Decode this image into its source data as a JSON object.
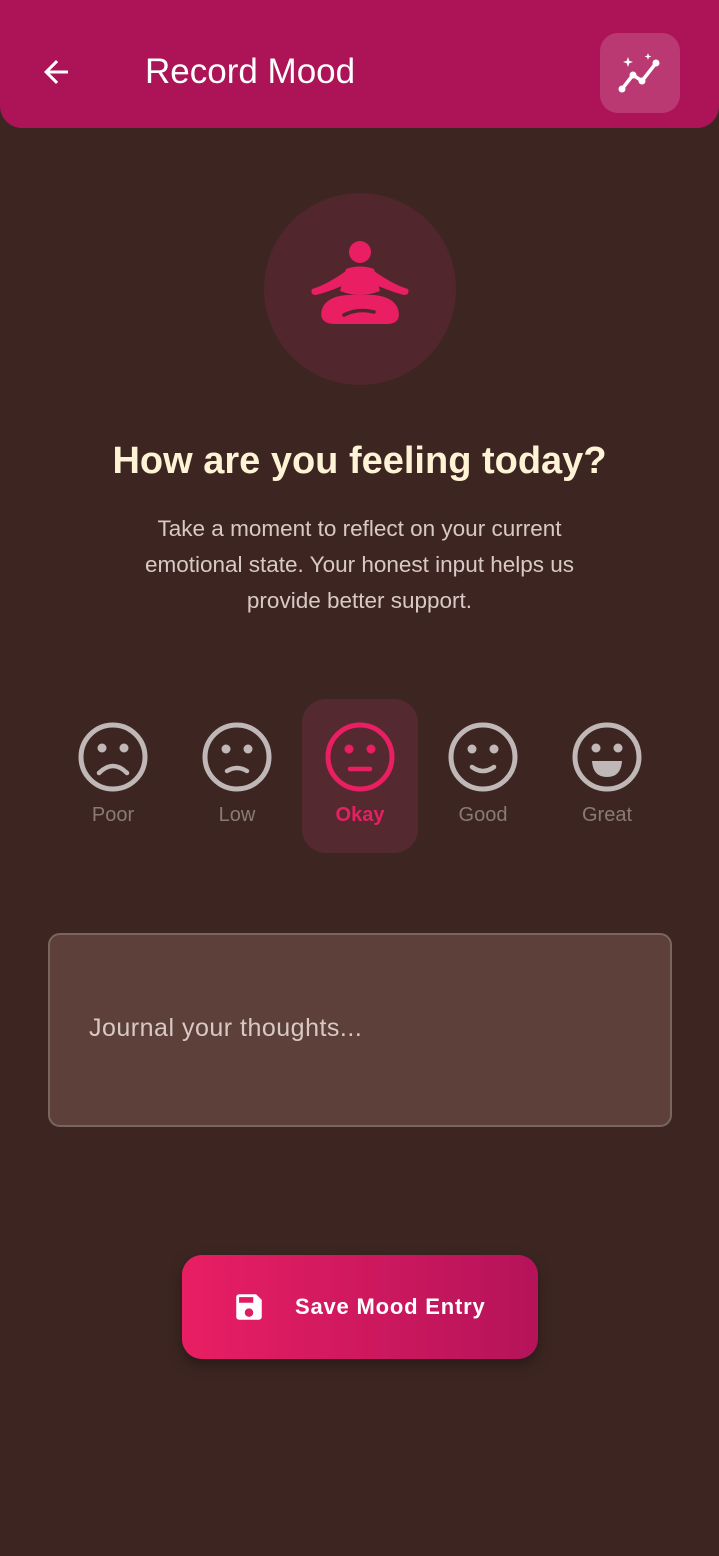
{
  "app_bar": {
    "title": "Record Mood",
    "back_icon": "arrow-left-icon",
    "action_icon": "insights-icon"
  },
  "hero": {
    "icon": "meditation-icon"
  },
  "prompt": {
    "heading": "How are you feeling today?",
    "subtitle": "Take a moment to reflect on your current emotional state. Your honest input helps us provide better support."
  },
  "moods": {
    "selected": "Okay",
    "items": [
      {
        "label": "Poor",
        "icon": "sad-face-icon"
      },
      {
        "label": "Low",
        "icon": "dissatisfied-face-icon"
      },
      {
        "label": "Okay",
        "icon": "neutral-face-icon"
      },
      {
        "label": "Good",
        "icon": "satisfied-face-icon"
      },
      {
        "label": "Great",
        "icon": "very-satisfied-face-icon"
      }
    ]
  },
  "journal": {
    "placeholder": "Journal your thoughts...",
    "value": ""
  },
  "save_button": {
    "label": "Save Mood Entry",
    "icon": "save-icon"
  },
  "colors": {
    "background": "#3d2622",
    "app_bar": "#ad1457",
    "accent": "#e91e63",
    "heading": "#fff3d6",
    "inactive_face": "#c0b8b6"
  }
}
